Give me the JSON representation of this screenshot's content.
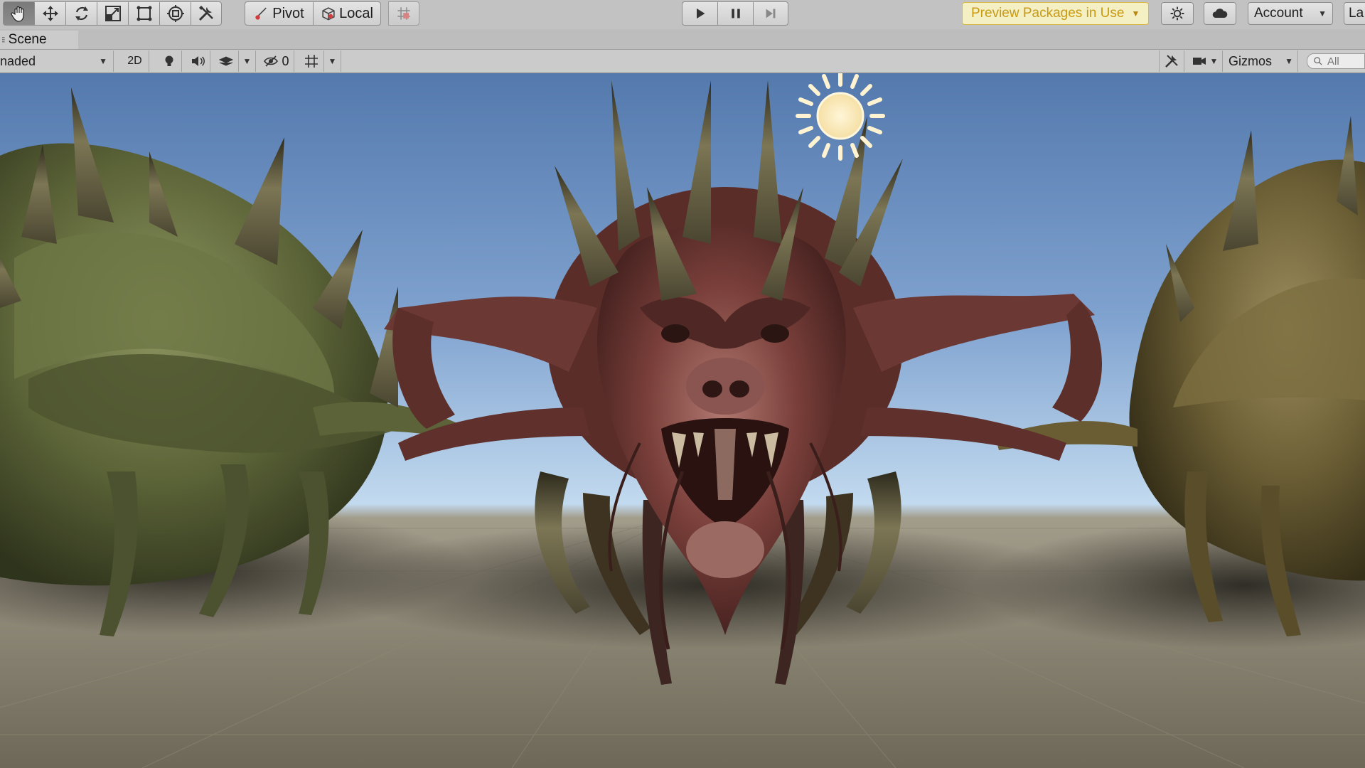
{
  "main_toolbar": {
    "transform_tools": [
      "hand-tool",
      "move-tool",
      "rotate-tool",
      "scale-tool",
      "rect-tool",
      "transform-tool",
      "custom-tools"
    ],
    "pivot_label": "Pivot",
    "local_label": "Local",
    "preview_packages_label": "Preview Packages in Use",
    "account_label": "Account",
    "layers_label": "La"
  },
  "scene_tab": {
    "label": "Scene"
  },
  "scene_toolbar": {
    "shading_mode": "naded",
    "mode_2d_label": "2D",
    "hidden_count": "0",
    "gizmos_label": "Gizmos",
    "search_placeholder": "All"
  },
  "colors": {
    "toolbar_bg": "#c2c2c2",
    "preview_packages_bg": "#f5efc4",
    "preview_packages_text": "#c79a12",
    "sky_top": "#5e82b5",
    "sky_horizon": "#bcd6ee",
    "ground": "#76705f"
  }
}
